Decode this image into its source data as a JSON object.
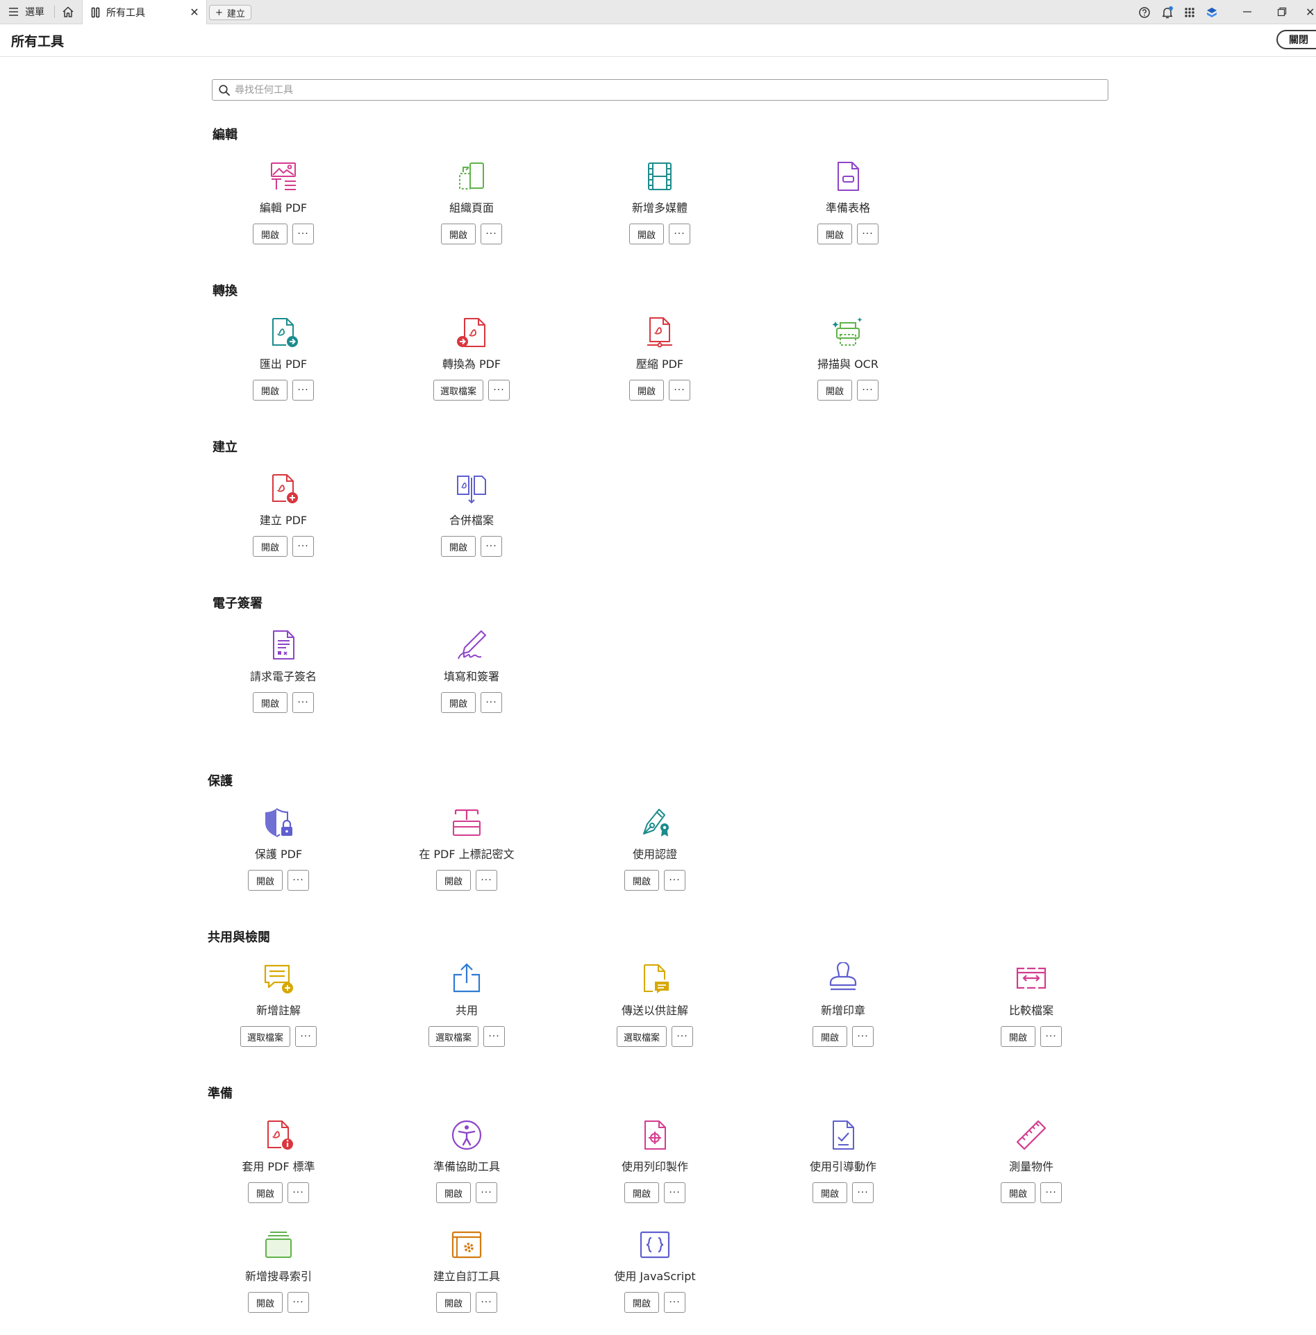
{
  "tabbar": {
    "menu_label": "選單",
    "active_tab": "所有工具",
    "create_label": "建立"
  },
  "header": {
    "title": "所有工具",
    "close_label": "關閉"
  },
  "search": {
    "placeholder": "尋找任何工具"
  },
  "colors": {
    "edit_pink": "#d43c8f",
    "organize_green": "#60b24a",
    "teal": "#1c8c8c",
    "purple": "#8e44c8",
    "red": "#d9363e",
    "blue": "#2f7bd3",
    "indigo": "#5f5fcf",
    "yellow": "#d6a800",
    "orange": "#d37a12"
  },
  "sections": [
    {
      "title": "編輯",
      "tools": [
        {
          "label": "編輯 PDF",
          "icon": "edit-pdf-icon",
          "button": "開啟"
        },
        {
          "label": "組織頁面",
          "icon": "organize-pages-icon",
          "button": "開啟"
        },
        {
          "label": "新增多媒體",
          "icon": "add-rich-media-icon",
          "button": "開啟"
        },
        {
          "label": "準備表格",
          "icon": "prepare-form-icon",
          "button": "開啟"
        }
      ]
    },
    {
      "title": "轉換",
      "tools": [
        {
          "label": "匯出 PDF",
          "icon": "export-pdf-icon",
          "button": "開啟"
        },
        {
          "label": "轉換為 PDF",
          "icon": "convert-to-pdf-icon",
          "button": "選取檔案"
        },
        {
          "label": "壓縮 PDF",
          "icon": "compress-pdf-icon",
          "button": "開啟"
        },
        {
          "label": "掃描與 OCR",
          "icon": "scan-ocr-icon",
          "button": "開啟"
        }
      ]
    },
    {
      "title": "建立",
      "tools": [
        {
          "label": "建立 PDF",
          "icon": "create-pdf-icon",
          "button": "開啟"
        },
        {
          "label": "合併檔案",
          "icon": "combine-files-icon",
          "button": "開啟"
        }
      ]
    },
    {
      "title": "電子簽署",
      "tools": [
        {
          "label": "請求電子簽名",
          "icon": "request-esign-icon",
          "button": "開啟"
        },
        {
          "label": "填寫和簽署",
          "icon": "fill-sign-icon",
          "button": "開啟"
        }
      ]
    },
    {
      "title": "保護",
      "tools": [
        {
          "label": "保護 PDF",
          "icon": "protect-pdf-icon",
          "button": "開啟"
        },
        {
          "label": "在 PDF 上標記密文",
          "icon": "redact-icon",
          "button": "開啟"
        },
        {
          "label": "使用認證",
          "icon": "certificate-icon",
          "button": "開啟"
        }
      ]
    },
    {
      "title": "共用與檢閱",
      "tools": [
        {
          "label": "新增註解",
          "icon": "add-comment-icon",
          "button": "選取檔案"
        },
        {
          "label": "共用",
          "icon": "share-icon",
          "button": "選取檔案"
        },
        {
          "label": "傳送以供註解",
          "icon": "send-for-comments-icon",
          "button": "選取檔案"
        },
        {
          "label": "新增印章",
          "icon": "stamp-icon",
          "button": "開啟"
        },
        {
          "label": "比較檔案",
          "icon": "compare-files-icon",
          "button": "開啟"
        }
      ]
    },
    {
      "title": "準備",
      "tools": [
        {
          "label": "套用 PDF 標準",
          "icon": "pdf-standards-icon",
          "button": "開啟"
        },
        {
          "label": "準備協助工具",
          "icon": "accessibility-icon",
          "button": "開啟"
        },
        {
          "label": "使用列印製作",
          "icon": "print-production-icon",
          "button": "開啟"
        },
        {
          "label": "使用引導動作",
          "icon": "guided-actions-icon",
          "button": "開啟"
        },
        {
          "label": "測量物件",
          "icon": "measure-icon",
          "button": "開啟"
        },
        {
          "label": "新增搜尋索引",
          "icon": "search-index-icon",
          "button": "開啟"
        },
        {
          "label": "建立自訂工具",
          "icon": "custom-tool-icon",
          "button": "開啟"
        },
        {
          "label": "使用 JavaScript",
          "icon": "javascript-icon",
          "button": "開啟"
        }
      ]
    }
  ],
  "more_label": "···"
}
